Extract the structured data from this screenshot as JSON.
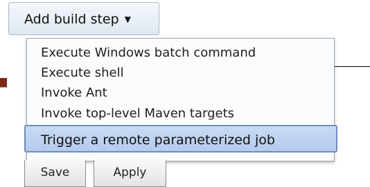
{
  "add_step_button": {
    "label": "Add build step",
    "caret": "▼"
  },
  "dropdown": {
    "items": [
      {
        "label": "Execute Windows batch command"
      },
      {
        "label": "Execute shell"
      },
      {
        "label": "Invoke Ant"
      },
      {
        "label": "Invoke top-level Maven targets"
      },
      {
        "label": "Trigger a remote parameterized job"
      }
    ],
    "selected_index": 4
  },
  "form_buttons": {
    "save_label": "Save",
    "apply_label": "Apply"
  },
  "colors": {
    "highlight": "#c9daf3",
    "highlight_border": "#6f8fb8"
  }
}
